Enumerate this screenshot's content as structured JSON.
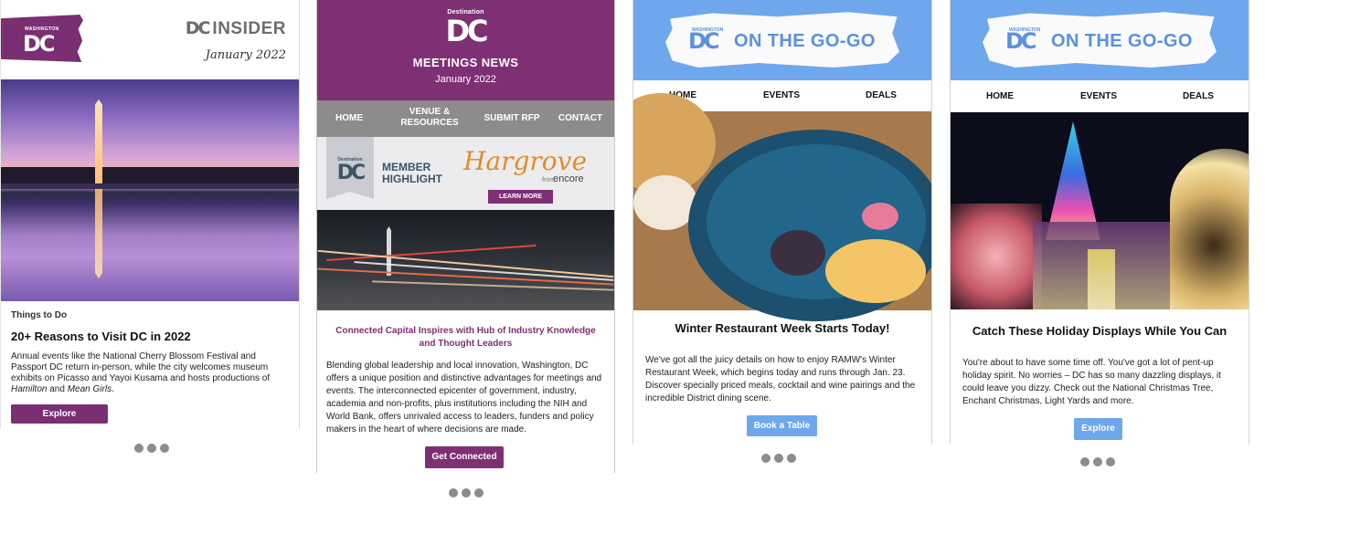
{
  "card1": {
    "logo_small": "WASHINGTON",
    "logo_dc": "DC",
    "insider_dc": "DC",
    "insider_word": "INSIDER",
    "date": "January 2022",
    "kicker": "Things to Do",
    "title": "20+ Reasons to Visit DC in 2022",
    "body_before": "Annual events like the National Cherry Blossom Festival and Passport DC return in-person, while the city welcomes museum exhibits on Picasso and Yayoi Kusama and hosts productions of ",
    "body_em1": "Hamilton",
    "body_mid": " and ",
    "body_em2": "Mean Girls",
    "body_end": ".",
    "button": "Explore"
  },
  "card2": {
    "destination": "Destination",
    "logo_dc": "DC",
    "title": "MEETINGS NEWS",
    "date": "January 2022",
    "nav": [
      "HOME",
      "VENUE & RESOURCES",
      "SUBMIT RFP",
      "CONTACT"
    ],
    "banner_destination": "Destination",
    "banner_dc": "DC",
    "banner_label_1": "MEMBER",
    "banner_label_2": "HIGHLIGHT",
    "brand": "Hargrove",
    "brand_from": "from",
    "brand_encore": "encore",
    "banner_button": "LEARN MORE",
    "headline": "Connected Capital Inspires with Hub of Industry Knowledge and Thought Leaders",
    "body": "Blending global leadership and local innovation, Washington, DC offers a unique position and distinctive advantages for meetings and events. The interconnected epicenter of government, industry, academia and non-profits, plus institutions including the NIH and World Bank, offers unrivaled access to leaders, funders and policy makers in the heart of where decisions are made.",
    "button": "Get Connected"
  },
  "card3": {
    "logo_small": "WASHINGTON",
    "logo_dc": "DC",
    "logo_text": "ON THE GO-GO",
    "nav": [
      "HOME",
      "EVENTS",
      "DEALS"
    ],
    "headline": "Winter Restaurant Week Starts Today!",
    "body": "We've got all the juicy details on how to enjoy RAMW's Winter Restaurant Week, which begins today and runs through Jan. 23. Discover specially priced meals, cocktail and wine pairings and the incredible District dining scene.",
    "button": "Book a Table"
  },
  "card4": {
    "logo_small": "WASHINGTON",
    "logo_dc": "DC",
    "logo_text": "ON THE GO-GO",
    "nav": [
      "HOME",
      "EVENTS",
      "DEALS"
    ],
    "headline": "Catch These Holiday Displays While You Can",
    "body": "You're about to have some time off. You've got a lot of pent-up holiday spirit. No worries – DC has so many dazzling displays, it could leave you dizzy. Check out the National Christmas Tree, Enchant Christmas, Light Yards and more.",
    "button": "Explore"
  },
  "colors": {
    "purple": "#7a2f73",
    "blue": "#6fa7ec",
    "nav_gray": "#8c8c8c",
    "dot_gray": "#8c8c8c"
  }
}
